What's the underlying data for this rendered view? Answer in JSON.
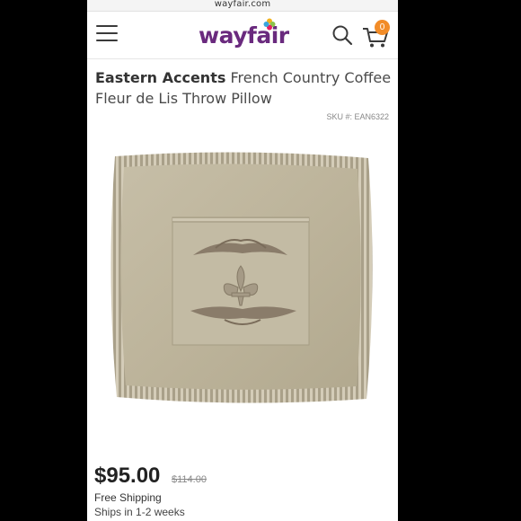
{
  "browser": {
    "url": "wayfair.com"
  },
  "header": {
    "logo_text": "wayfair",
    "cart_count": "0"
  },
  "product": {
    "brand": "Eastern Accents",
    "name": "French Country Coffee Fleur de Lis Throw Pillow",
    "sku_label": "SKU #:",
    "sku": "EAN6322",
    "price": "$95.00",
    "original_price": "$114.00",
    "shipping": "Free Shipping",
    "ships_in": "Ships in 1-2 weeks"
  },
  "icons": {
    "menu": "hamburger-menu-icon",
    "search": "search-icon",
    "cart": "cart-icon"
  },
  "colors": {
    "brand_purple": "#6a2a7e",
    "badge_orange": "#f28c28"
  }
}
